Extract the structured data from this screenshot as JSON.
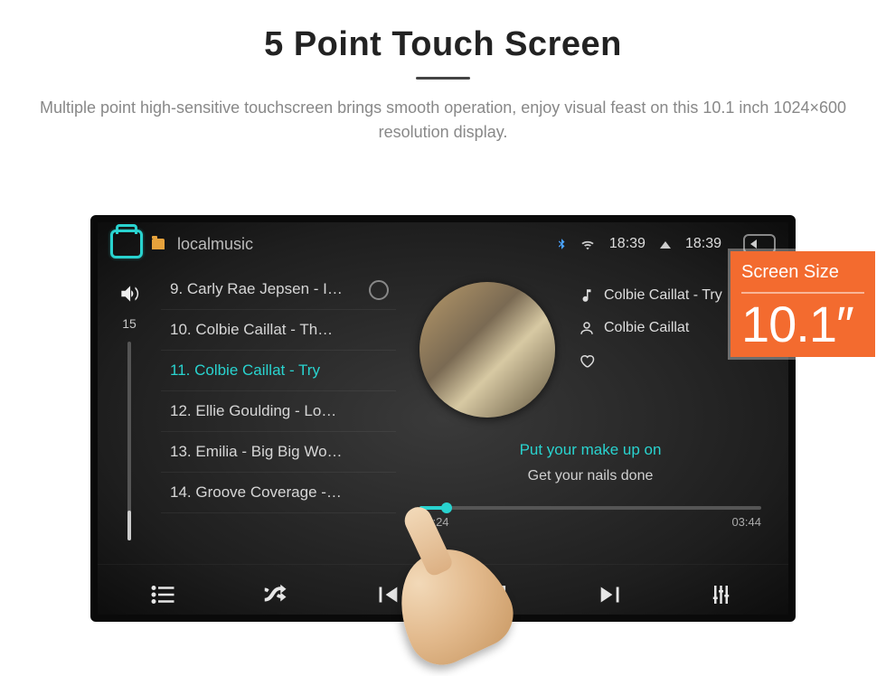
{
  "hero": {
    "title": "5 Point Touch Screen",
    "subtitle": "Multiple point high-sensitive touchscreen brings smooth operation, enjoy visual feast on this 10.1 inch 1024×600 resolution display."
  },
  "statusbar": {
    "app_title": "localmusic",
    "clock_left": "18:39",
    "clock_right": "18:39"
  },
  "volume": {
    "level": "15"
  },
  "playlist": [
    {
      "label": "9. Carly Rae Jepsen - I…"
    },
    {
      "label": "10. Colbie Caillat - Th…"
    },
    {
      "label": "11. Colbie Caillat - Try",
      "active": true
    },
    {
      "label": "12. Ellie Goulding - Lo…"
    },
    {
      "label": "13. Emilia - Big Big Wo…"
    },
    {
      "label": "14. Groove Coverage -…"
    }
  ],
  "nowplaying": {
    "song": "Colbie Caillat - Try",
    "artist": "Colbie Caillat",
    "lyric_current": "Put your make up on",
    "lyric_next": "Get your nails done",
    "time_elapsed": "00:24",
    "time_total": "03:44"
  },
  "badge": {
    "label": "Screen Size",
    "value": "10.1″"
  }
}
